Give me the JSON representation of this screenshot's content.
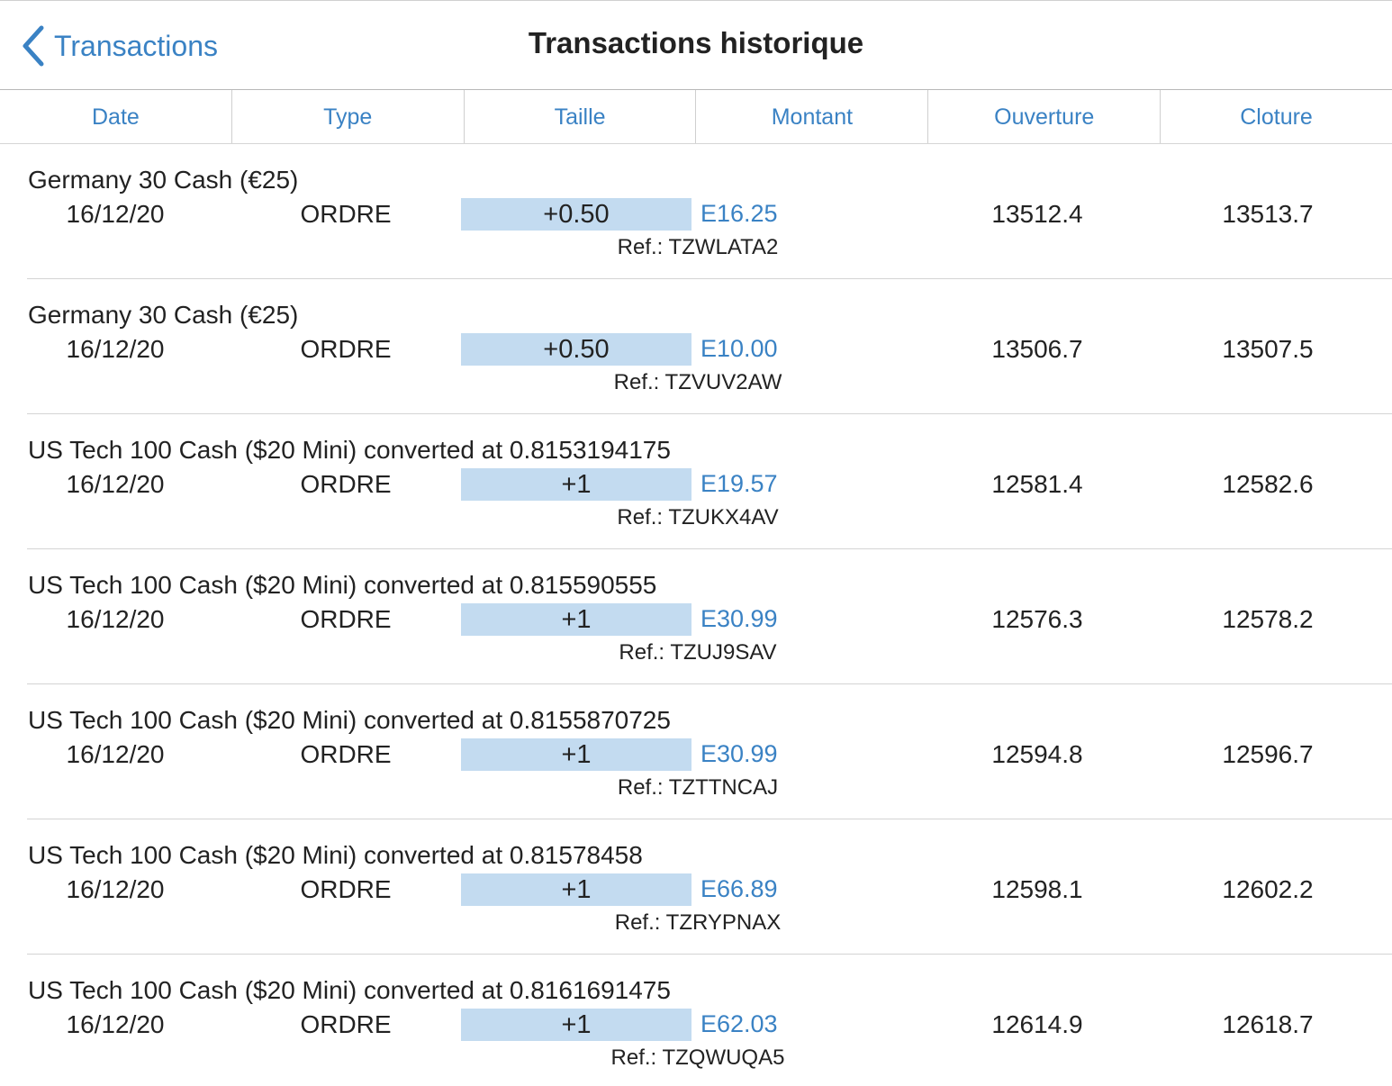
{
  "nav": {
    "back_label": "Transactions",
    "title": "Transactions historique"
  },
  "columns": [
    "Date",
    "Type",
    "Taille",
    "Montant",
    "Ouverture",
    "Cloture"
  ],
  "rows": [
    {
      "instrument": "Germany 30 Cash (€25)",
      "date": "16/12/20",
      "type": "ORDRE",
      "size": "+0.50",
      "amount": "E16.25",
      "ref": "Ref.: TZWLATA2",
      "open": "13512.4",
      "close": "13513.7"
    },
    {
      "instrument": "Germany 30 Cash (€25)",
      "date": "16/12/20",
      "type": "ORDRE",
      "size": "+0.50",
      "amount": "E10.00",
      "ref": "Ref.: TZVUV2AW",
      "open": "13506.7",
      "close": "13507.5"
    },
    {
      "instrument": "US Tech 100 Cash ($20 Mini) converted at 0.8153194175",
      "date": "16/12/20",
      "type": "ORDRE",
      "size": "+1",
      "amount": "E19.57",
      "ref": "Ref.: TZUKX4AV",
      "open": "12581.4",
      "close": "12582.6"
    },
    {
      "instrument": "US Tech 100 Cash ($20 Mini) converted at 0.815590555",
      "date": "16/12/20",
      "type": "ORDRE",
      "size": "+1",
      "amount": "E30.99",
      "ref": "Ref.: TZUJ9SAV",
      "open": "12576.3",
      "close": "12578.2"
    },
    {
      "instrument": "US Tech 100 Cash ($20 Mini) converted at 0.8155870725",
      "date": "16/12/20",
      "type": "ORDRE",
      "size": "+1",
      "amount": "E30.99",
      "ref": "Ref.: TZTTNCAJ",
      "open": "12594.8",
      "close": "12596.7"
    },
    {
      "instrument": "US Tech 100 Cash ($20 Mini) converted at 0.81578458",
      "date": "16/12/20",
      "type": "ORDRE",
      "size": "+1",
      "amount": "E66.89",
      "ref": "Ref.: TZRYPNAX",
      "open": "12598.1",
      "close": "12602.2"
    },
    {
      "instrument": "US Tech 100 Cash ($20 Mini) converted at 0.8161691475",
      "date": "16/12/20",
      "type": "ORDRE",
      "size": "+1",
      "amount": "E62.03",
      "ref": "Ref.: TZQWUQA5",
      "open": "12614.9",
      "close": "12618.7"
    }
  ],
  "colors": {
    "accent": "#3a82c4",
    "size_highlight": "#c3dbf0",
    "text": "#222222"
  },
  "icons": {
    "back": "chevron-left-icon"
  }
}
